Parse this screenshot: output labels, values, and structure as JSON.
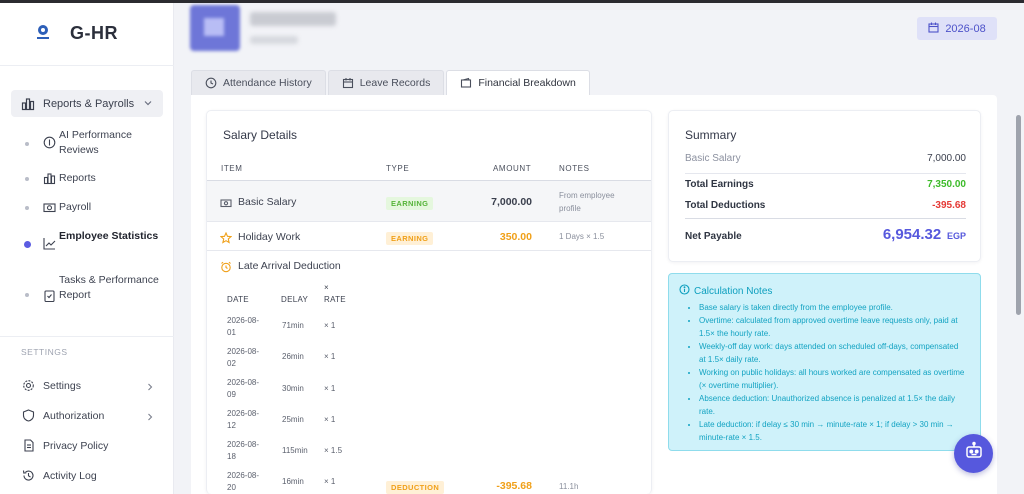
{
  "app": {
    "name": "G-HR"
  },
  "sidebar": {
    "group": {
      "label": "Reports & Payrolls"
    },
    "items": [
      {
        "label": "AI Performance Reviews"
      },
      {
        "label": "Reports"
      },
      {
        "label": "Payroll"
      },
      {
        "label": "Employee Statistics",
        "active": true
      },
      {
        "label": "Tasks & Performance Report"
      }
    ],
    "settings_label": "SETTINGS",
    "settings_items": [
      {
        "label": "Settings"
      },
      {
        "label": "Authorization"
      },
      {
        "label": "Privacy Policy"
      },
      {
        "label": "Activity Log"
      }
    ]
  },
  "header": {
    "period": "2026-08"
  },
  "tabs": [
    {
      "label": "Attendance History"
    },
    {
      "label": "Leave Records"
    },
    {
      "label": "Financial Breakdown",
      "active": true
    }
  ],
  "salary": {
    "title": "Salary Details",
    "columns": {
      "item": "ITEM",
      "type": "TYPE",
      "amount": "AMOUNT",
      "notes": "NOTES"
    },
    "rows": [
      {
        "item": "Basic Salary",
        "type": "EARNING",
        "amount": "7,000.00",
        "notes_l1": "From employee",
        "notes_l2": "profile"
      },
      {
        "item": "Holiday Work",
        "type": "EARNING",
        "amount": "350.00",
        "notes": "1 Days × 1.5"
      },
      {
        "item": "Late Arrival Deduction",
        "type": "DEDUCTION",
        "amount": "-395.68",
        "notes": "11.1h"
      }
    ],
    "late_table": {
      "columns": {
        "date": "DATE",
        "delay": "DELAY",
        "rate_l1": "×",
        "rate_l2": "RATE"
      },
      "rows": [
        {
          "date_l1": "2026-08-",
          "date_l2": "01",
          "delay": "71min",
          "rate": "× 1"
        },
        {
          "date_l1": "2026-08-",
          "date_l2": "02",
          "delay": "26min",
          "rate": "× 1"
        },
        {
          "date_l1": "2026-08-",
          "date_l2": "09",
          "delay": "30min",
          "rate": "× 1"
        },
        {
          "date_l1": "2026-08-",
          "date_l2": "12",
          "delay": "25min",
          "rate": "× 1"
        },
        {
          "date_l1": "2026-08-",
          "date_l2": "18",
          "delay": "115min",
          "rate": "× 1.5"
        },
        {
          "date_l1": "2026-08-",
          "date_l2": "20",
          "delay": "16min",
          "rate": "× 1"
        }
      ]
    }
  },
  "summary": {
    "title": "Summary",
    "basic_label": "Basic Salary",
    "basic_value": "7,000.00",
    "earnings_label": "Total Earnings",
    "earnings_value": "7,350.00",
    "deductions_label": "Total Deductions",
    "deductions_value": "-395.68",
    "net_label": "Net Payable",
    "net_value": "6,954.32",
    "currency": "EGP"
  },
  "calc_notes": {
    "title": "Calculation Notes",
    "items": [
      "Base salary is taken directly from the employee profile.",
      "Overtime: calculated from approved overtime leave requests only, paid at 1.5× the hourly rate.",
      "Weekly-off day work: days attended on scheduled off-days, compensated at 1.5× daily rate.",
      "Working on public holidays: all hours worked are compensated as overtime (× overtime multiplier).",
      "Absence deduction: Unauthorized absence is penalized at 1.5× the daily rate.",
      "Late deduction: if delay ≤ 30 min → minute-rate × 1; if delay > 30 min → minute-rate × 1.5."
    ]
  },
  "colors": {
    "accent": "#5658dd",
    "earning": "#3dbb2a",
    "deduction": "#e53935",
    "amount_orange": "#f0a019"
  }
}
